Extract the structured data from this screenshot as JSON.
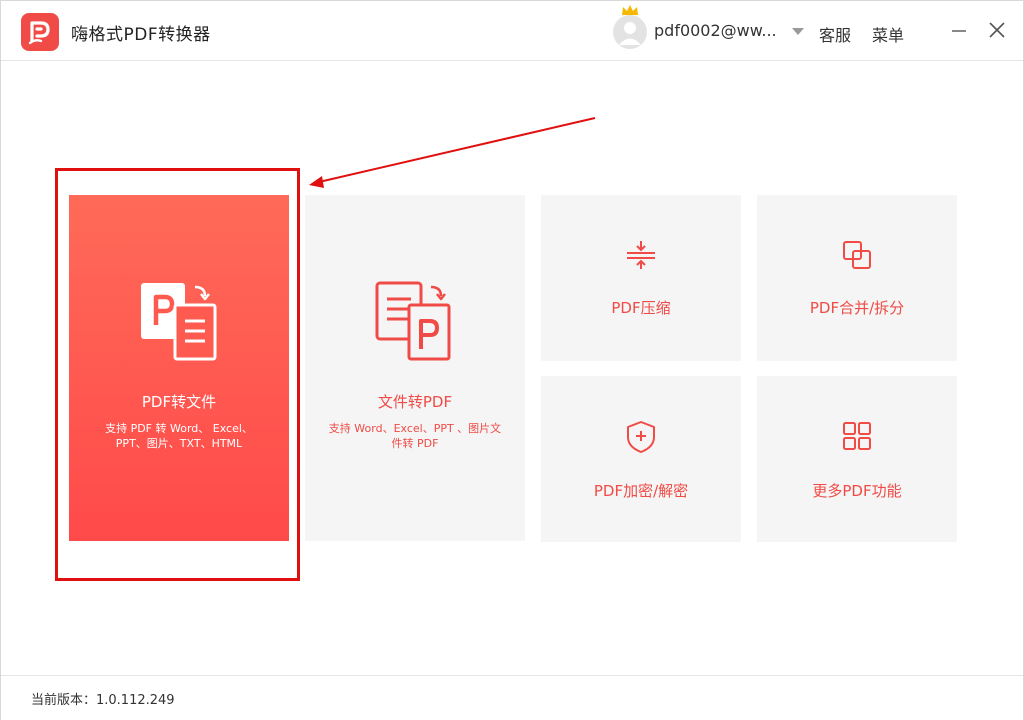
{
  "app": {
    "title": "嗨格式PDF转换器",
    "brand_color": "#f04b46"
  },
  "header": {
    "user_name": "pdf0002@ww...",
    "service_label": "客服",
    "menu_label": "菜单"
  },
  "tiles": {
    "pdf_to_file": {
      "label": "PDF转文件",
      "desc_line1": "支持 PDF 转 Word、 Excel、",
      "desc_line2": "PPT、图片、TXT、HTML",
      "icon": "pdf-to-file-icon"
    },
    "file_to_pdf": {
      "label": "文件转PDF",
      "desc_line1": "支持 Word、Excel、PPT 、图片文",
      "desc_line2": "件转 PDF",
      "icon": "file-to-pdf-icon"
    },
    "compress": {
      "label": "PDF压缩",
      "icon": "compress-icon"
    },
    "merge": {
      "label": "PDF合并/拆分",
      "icon": "merge-split-icon"
    },
    "encrypt": {
      "label": "PDF加密/解密",
      "icon": "shield-icon"
    },
    "more": {
      "label": "更多PDF功能",
      "icon": "grid-icon"
    }
  },
  "footer": {
    "version": "当前版本：1.0.112.249"
  },
  "annotation": {
    "highlight_color": "#e01010"
  }
}
